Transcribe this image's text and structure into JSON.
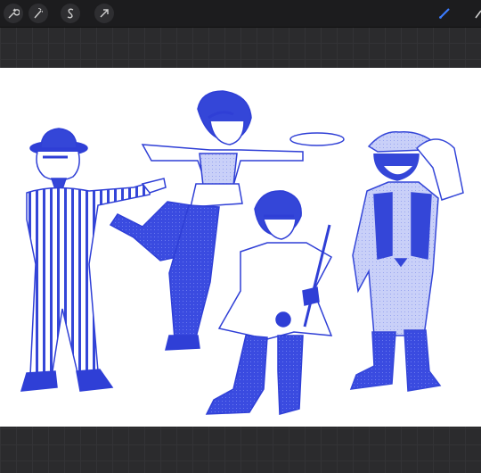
{
  "toolbar": {
    "left_tools": [
      "wrench-icon",
      "adjustments-wand-icon",
      "selection-s-icon",
      "transform-arrow-icon"
    ],
    "right_tools": [
      "brush-icon",
      "smudge-icon"
    ],
    "active_color": "#3b7cff"
  },
  "canvas": {
    "ink_color": "#2f3fd6",
    "light_ink": "#6a7ae8"
  }
}
